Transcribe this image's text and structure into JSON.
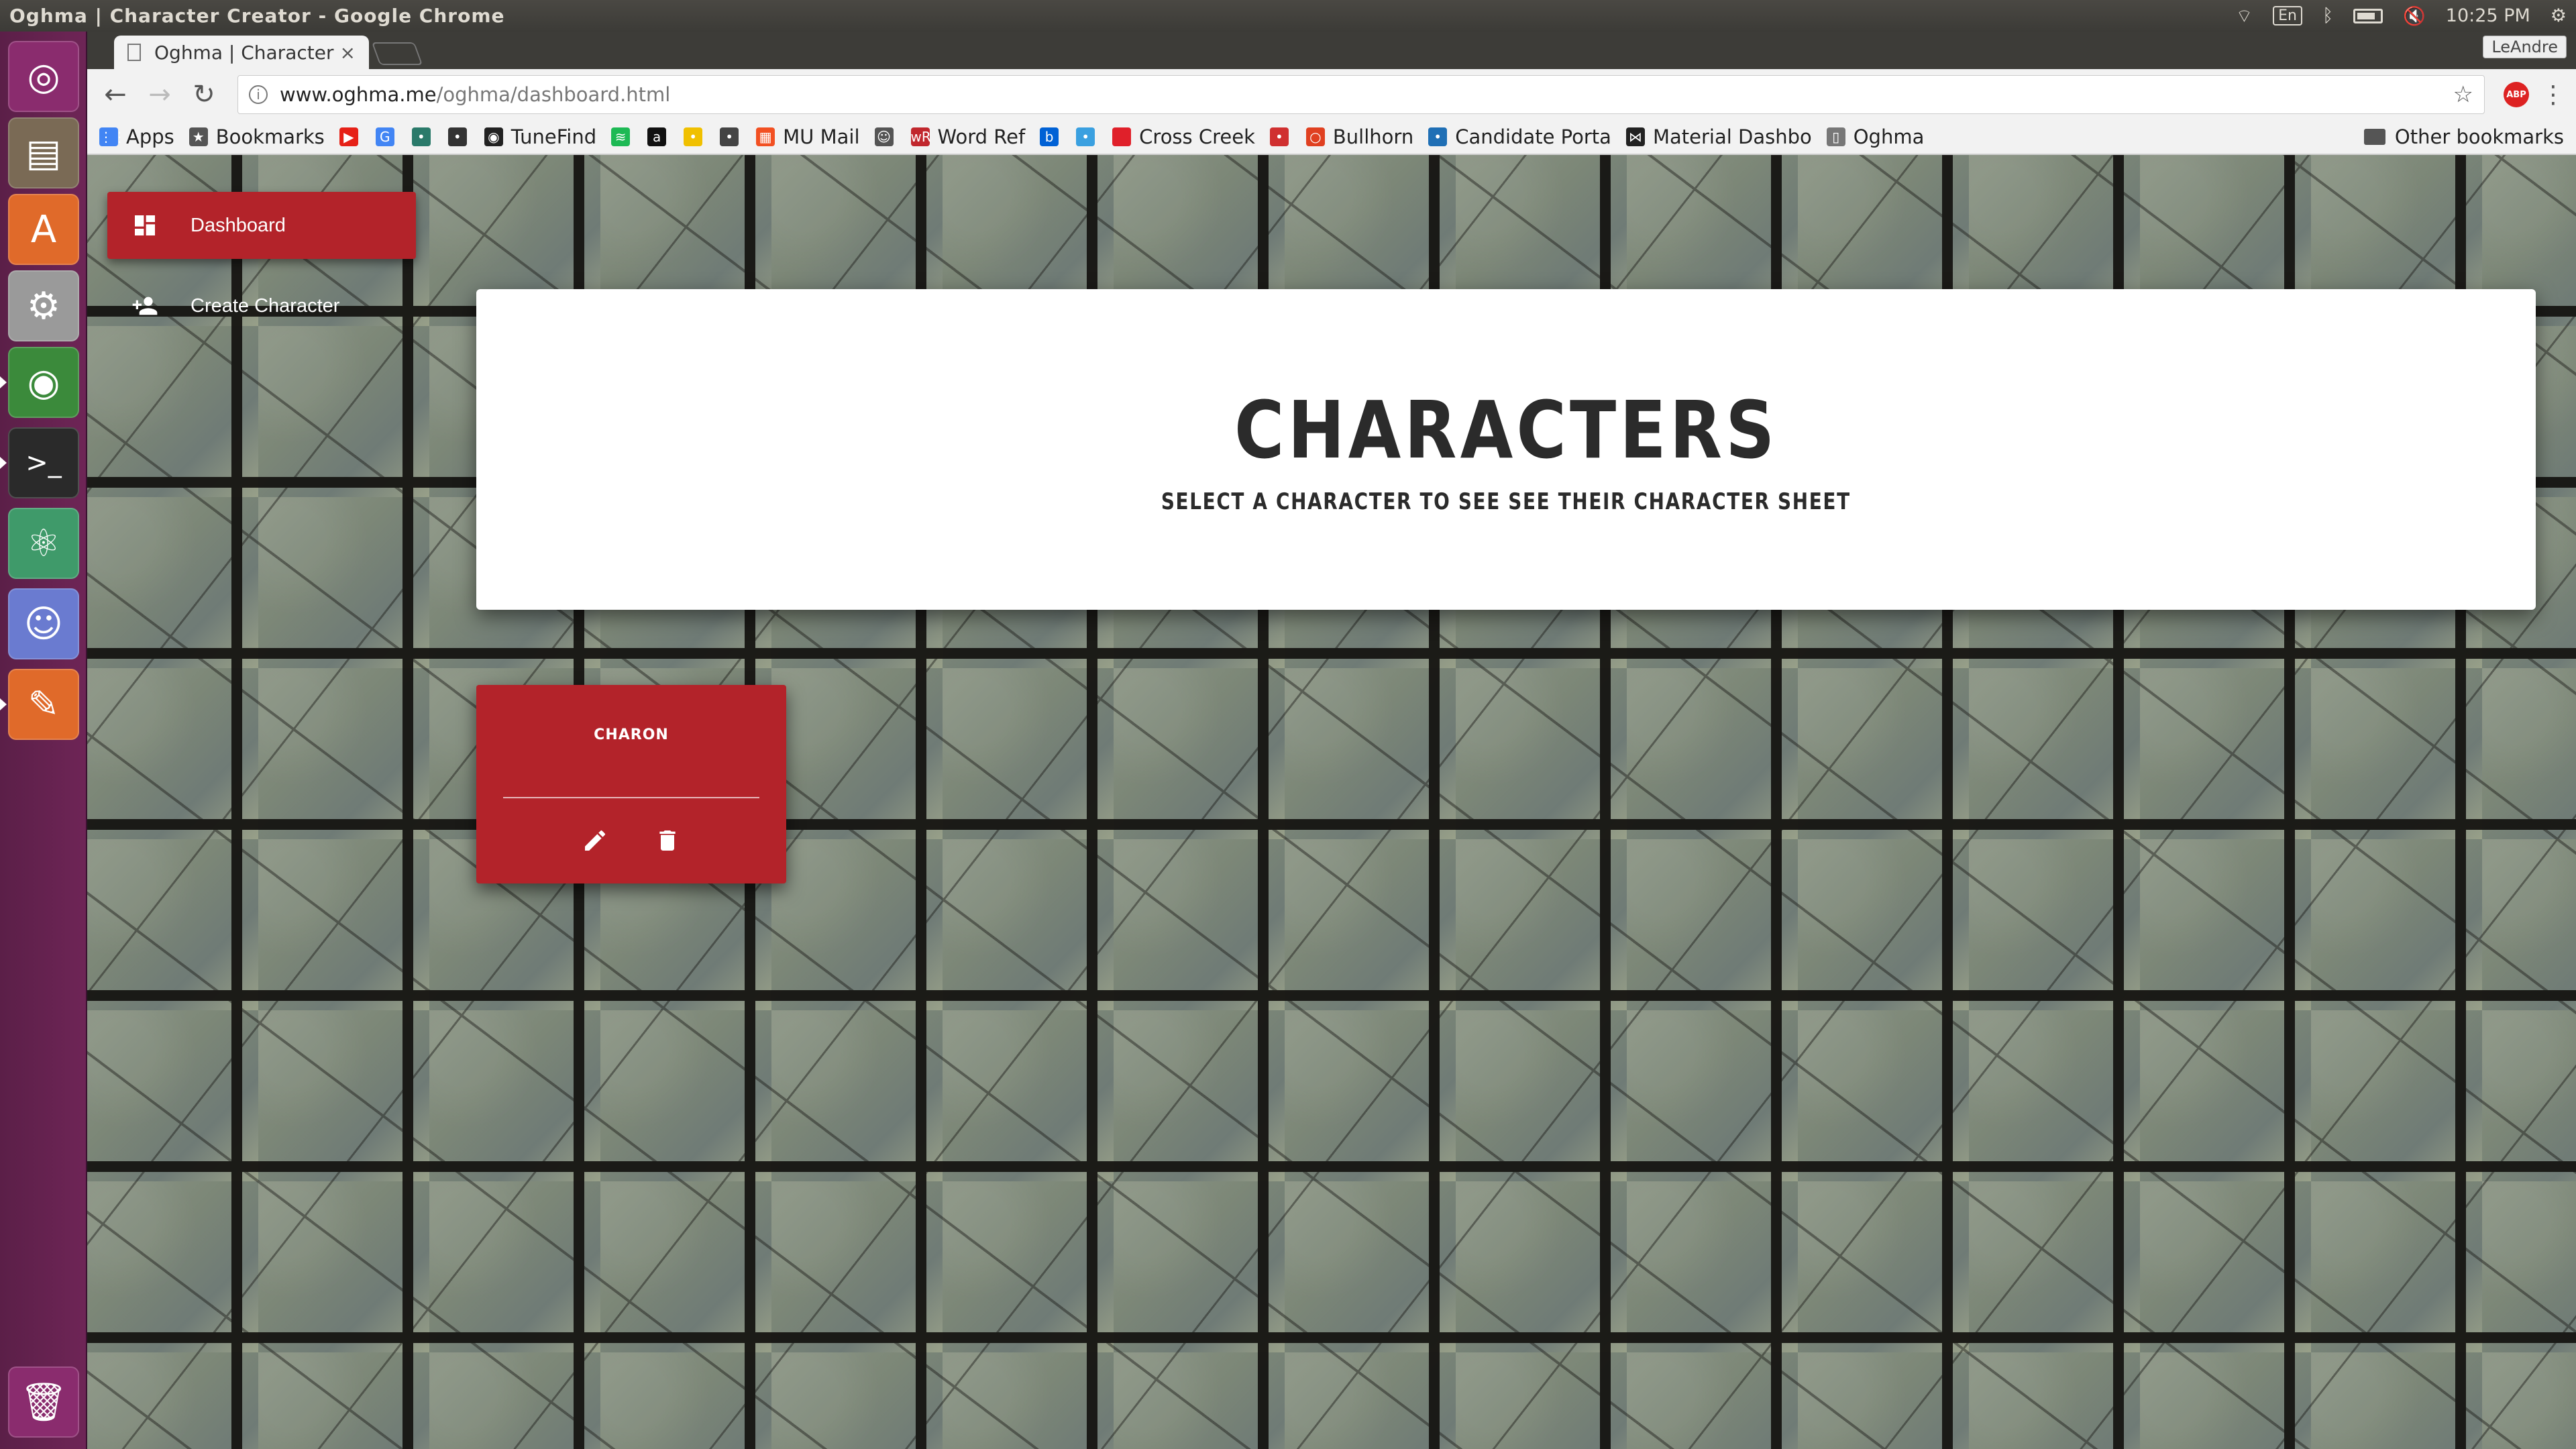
{
  "os": {
    "window_title": "Oghma | Character Creator - Google Chrome",
    "keyboard_layout": "En",
    "clock": "10:25 PM"
  },
  "browser": {
    "tab_title": "Oghma | Character",
    "tab_close": "×",
    "user_badge": "LeAndre",
    "url_host": "www.oghma.me",
    "url_path": "/oghma/dashboard.html",
    "abp_label": "ABP",
    "bookmarks": [
      {
        "label": "Apps",
        "icon": "apps-grid-icon",
        "color": "#4285f4"
      },
      {
        "label": "Bookmarks",
        "icon": "star-icon",
        "color": "#555555"
      },
      {
        "label": "",
        "icon": "youtube-icon",
        "color": "#e62117"
      },
      {
        "label": "",
        "icon": "google-icon",
        "color": "#4285f4"
      },
      {
        "label": "",
        "icon": "site-icon",
        "color": "#2a7a6a"
      },
      {
        "label": "",
        "icon": "site-icon",
        "color": "#333333"
      },
      {
        "label": "TuneFind",
        "icon": "tunefind-icon",
        "color": "#222222"
      },
      {
        "label": "",
        "icon": "spotify-icon",
        "color": "#1db954"
      },
      {
        "label": "",
        "icon": "amazon-icon",
        "color": "#111111"
      },
      {
        "label": "",
        "icon": "site-icon",
        "color": "#f0c000"
      },
      {
        "label": "",
        "icon": "site-icon",
        "color": "#444444"
      },
      {
        "label": "MU Mail",
        "icon": "microsoft-icon",
        "color": "#f25022"
      },
      {
        "label": "",
        "icon": "reddit-icon",
        "color": "#555555"
      },
      {
        "label": "Word Ref",
        "icon": "wordref-icon",
        "color": "#c1272d"
      },
      {
        "label": "",
        "icon": "box-icon",
        "color": "#0061d5"
      },
      {
        "label": "",
        "icon": "site-icon",
        "color": "#3aa0e0"
      },
      {
        "label": "Cross Creek",
        "icon": "red-square-icon",
        "color": "#e0202a"
      },
      {
        "label": "",
        "icon": "site-icon",
        "color": "#d03030"
      },
      {
        "label": "Bullhorn",
        "icon": "bullhorn-icon",
        "color": "#e04020"
      },
      {
        "label": "Candidate Porta",
        "icon": "site-icon",
        "color": "#1f6fb5"
      },
      {
        "label": "Material Dashbo",
        "icon": "bowtie-icon",
        "color": "#222222"
      },
      {
        "label": "Oghma",
        "icon": "doc-icon",
        "color": "#777777"
      }
    ],
    "other_bookmarks": "Other bookmarks"
  },
  "launcher": {
    "items": [
      {
        "name": "ubuntu-dash-icon",
        "glyph": "◎",
        "color": "#8a2c6e"
      },
      {
        "name": "files-icon",
        "glyph": "▤",
        "color": "#7a6a55"
      },
      {
        "name": "software-center-icon",
        "glyph": "A",
        "color": "#e06a2a"
      },
      {
        "name": "system-settings-icon",
        "glyph": "⚙",
        "color": "#9a9a9a"
      },
      {
        "name": "chrome-icon",
        "glyph": "◉",
        "color": "#3b8a3b"
      },
      {
        "name": "terminal-icon",
        "glyph": ">_",
        "color": "#2a2a2a"
      },
      {
        "name": "atom-icon",
        "glyph": "⚛",
        "color": "#3f9a6a"
      },
      {
        "name": "discord-icon",
        "glyph": "☺",
        "color": "#6a7bd0"
      },
      {
        "name": "editor-icon",
        "glyph": "✎",
        "color": "#e06a2a"
      }
    ],
    "trash": {
      "name": "trash-icon",
      "glyph": "🗑",
      "color": "#8a2c6e"
    }
  },
  "app": {
    "sidebar": [
      {
        "label": "Dashboard",
        "active": true,
        "icon": "dashboard-icon"
      },
      {
        "label": "Create Character",
        "active": false,
        "icon": "add-person-icon"
      }
    ],
    "header": {
      "title": "Characters",
      "subtitle": "Select a character to see see their character sheet"
    },
    "characters": [
      {
        "name": "Charon"
      }
    ],
    "colors": {
      "accent": "#b3232a",
      "card": "#ffffff"
    }
  }
}
